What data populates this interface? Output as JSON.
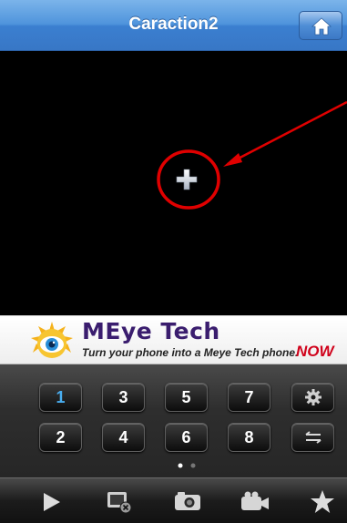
{
  "header": {
    "title": "Caraction2",
    "home_icon": "home-icon"
  },
  "video": {
    "add_icon": "plus-icon"
  },
  "ad": {
    "brand": "MEye Tech",
    "tagline": "Turn your phone into a Meye Tech phone.",
    "cta": "NOW"
  },
  "keypad": {
    "row1": [
      "1",
      "3",
      "5",
      "7"
    ],
    "row2": [
      "2",
      "4",
      "6",
      "8"
    ],
    "active": "1",
    "settings_icon": "gear-icon",
    "swap_icon": "swap-arrows-icon",
    "page_indicator": {
      "pages": 2,
      "current": 1
    }
  },
  "toolbar": {
    "icons": [
      "play-icon",
      "close-window-icon",
      "camera-icon",
      "video-record-icon",
      "star-icon"
    ]
  },
  "colors": {
    "header_blue": "#4f94dc",
    "active_key": "#49aef0",
    "annotation_red": "#e00000",
    "ad_cta": "#d0021b"
  }
}
